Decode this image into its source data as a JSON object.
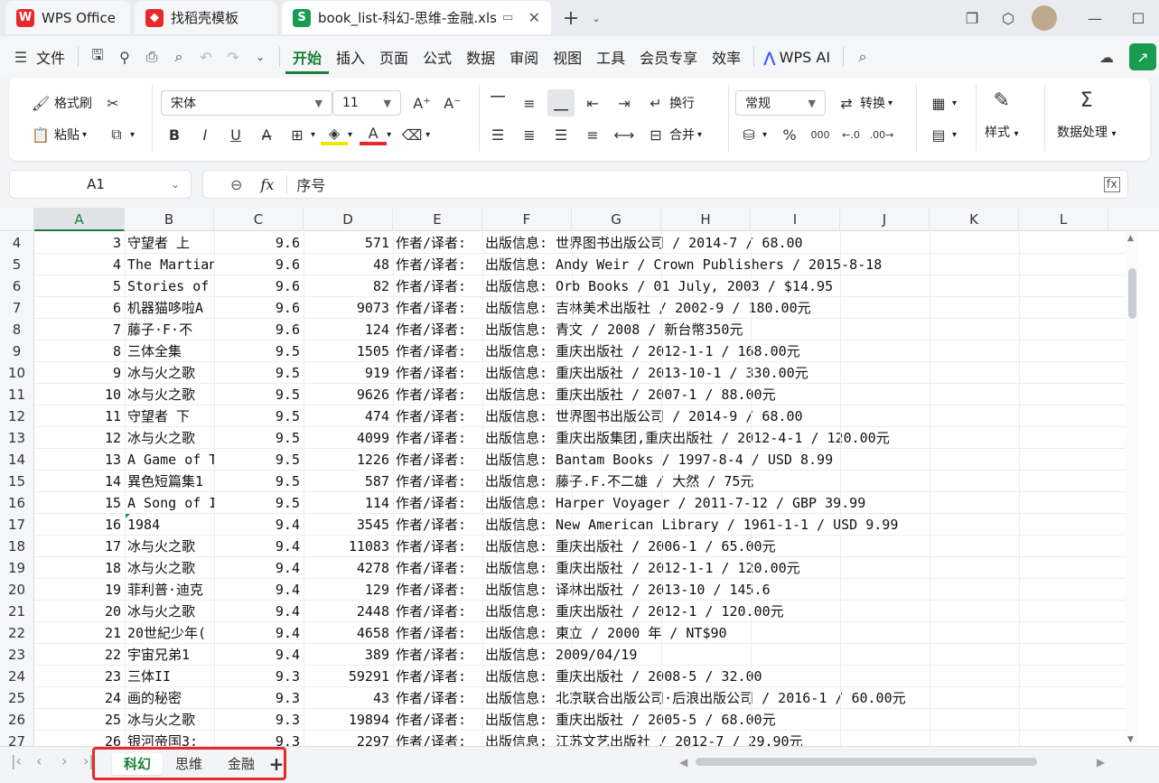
{
  "window": {
    "tabs": [
      {
        "label": "WPS Office",
        "logo": "W",
        "logo_color": "#e8292b"
      },
      {
        "label": "找稻壳模板",
        "logo": "◆",
        "logo_color": "#e8292b"
      },
      {
        "label": "book_list-科幻-思维-金融.xls",
        "logo": "S",
        "logo_color": "#1a9b52"
      }
    ]
  },
  "menu": {
    "file": "文件",
    "items": [
      "开始",
      "插入",
      "页面",
      "公式",
      "数据",
      "审阅",
      "视图",
      "工具",
      "会员专享",
      "效率"
    ],
    "active": "开始",
    "ai_label": "WPS AI"
  },
  "ribbon": {
    "format_painter": "格式刷",
    "paste": "粘贴",
    "font_name": "宋体",
    "font_size": "11",
    "wrap": "换行",
    "merge": "合并",
    "number_format": "常规",
    "convert": "转换",
    "style": "样式",
    "data_process": "数据处理"
  },
  "formula_bar": {
    "cell_ref": "A1",
    "content": "序号"
  },
  "columns": [
    "A",
    "B",
    "C",
    "D",
    "E",
    "F",
    "G",
    "H",
    "I",
    "J",
    "K",
    "L"
  ],
  "selected_column": "A",
  "rows": [
    {
      "rn": "4",
      "a": "3",
      "b": "守望者 上",
      "c": "9.6",
      "d": "571",
      "e": "作者/译者:",
      "f": "出版信息:  世界图书出版公司 / 2014-7 / 68.00"
    },
    {
      "rn": "5",
      "a": "4",
      "b": "The Martian",
      "c": "9.6",
      "d": "48",
      "e": "作者/译者:",
      "f": "出版信息: Andy Weir / Crown Publishers / 2015-8-18"
    },
    {
      "rn": "6",
      "a": "5",
      "b": "Stories of",
      "c": "9.6",
      "d": "82",
      "e": "作者/译者:",
      "f": "出版信息:  Orb Books / 01 July, 2003 / $14.95"
    },
    {
      "rn": "7",
      "a": "6",
      "b": "机器猫哆啦A",
      "c": "9.6",
      "d": "9073",
      "e": "作者/译者:",
      "f": "出版信息:  吉林美术出版社 / 2002-9 / 180.00元"
    },
    {
      "rn": "8",
      "a": "7",
      "b": "藤子·F·不",
      "c": "9.6",
      "d": "124",
      "e": "作者/译者:",
      "f": "出版信息:  青文 / 2008 / 新台幣350元"
    },
    {
      "rn": "9",
      "a": "8",
      "b": "三体全集",
      "c": "9.5",
      "d": "1505",
      "e": "作者/译者:",
      "f": "出版信息:  重庆出版社 / 2012-1-1 / 168.00元"
    },
    {
      "rn": "10",
      "a": "9",
      "b": "冰与火之歌",
      "c": "9.5",
      "d": "919",
      "e": "作者/译者:",
      "f": "出版信息:  重庆出版社 / 2013-10-1 / 330.00元"
    },
    {
      "rn": "11",
      "a": "10",
      "b": "冰与火之歌",
      "c": "9.5",
      "d": "9626",
      "e": "作者/译者:",
      "f": "出版信息:  重庆出版社 / 2007-1 / 88.00元"
    },
    {
      "rn": "12",
      "a": "11",
      "b": "守望者 下",
      "c": "9.5",
      "d": "474",
      "e": "作者/译者:",
      "f": "出版信息:  世界图书出版公司 / 2014-9 / 68.00"
    },
    {
      "rn": "13",
      "a": "12",
      "b": "冰与火之歌",
      "c": "9.5",
      "d": "4099",
      "e": "作者/译者:",
      "f": "出版信息:  重庆出版集团,重庆出版社 / 2012-4-1 / 120.00元"
    },
    {
      "rn": "14",
      "a": "13",
      "b": "A Game of T",
      "c": "9.5",
      "d": "1226",
      "e": "作者/译者:",
      "f": "出版信息:  Bantam Books / 1997-8-4 / USD 8.99"
    },
    {
      "rn": "15",
      "a": "14",
      "b": "異色短篇集1",
      "c": "9.5",
      "d": "587",
      "e": "作者/译者:",
      "f": "出版信息: 藤子.F.不二雄 / 大然 / 75元"
    },
    {
      "rn": "16",
      "a": "15",
      "b": "A Song of I",
      "c": "9.5",
      "d": "114",
      "e": "作者/译者:",
      "f": "出版信息:  Harper Voyager / 2011-7-12 / GBP 39.99"
    },
    {
      "rn": "17",
      "a": "16",
      "b": "1984",
      "c": "9.4",
      "d": "3545",
      "e": "作者/译者:",
      "f": "出版信息:  New American Library / 1961-1-1 / USD 9.99"
    },
    {
      "rn": "18",
      "a": "17",
      "b": "冰与火之歌",
      "c": "9.4",
      "d": "11083",
      "e": "作者/译者:",
      "f": "出版信息:  重庆出版社 / 2006-1 / 65.00元"
    },
    {
      "rn": "19",
      "a": "18",
      "b": "冰与火之歌",
      "c": "9.4",
      "d": "4278",
      "e": "作者/译者:",
      "f": "出版信息:  重庆出版社 / 2012-1-1 / 120.00元"
    },
    {
      "rn": "20",
      "a": "19",
      "b": "菲利普·迪克",
      "c": "9.4",
      "d": "129",
      "e": "作者/译者:",
      "f": "出版信息:  译林出版社 / 2013-10 / 145.6"
    },
    {
      "rn": "21",
      "a": "20",
      "b": "冰与火之歌",
      "c": "9.4",
      "d": "2448",
      "e": "作者/译者:",
      "f": "出版信息:  重庆出版社 / 2012-1 / 120.00元"
    },
    {
      "rn": "22",
      "a": "21",
      "b": "20世紀少年(",
      "c": "9.4",
      "d": "4658",
      "e": "作者/译者:",
      "f": "出版信息:  東立 / 2000 年 / NT$90"
    },
    {
      "rn": "23",
      "a": "22",
      "b": "宇宙兄弟1",
      "c": "9.4",
      "d": "389",
      "e": "作者/译者:",
      "f": "出版信息:  2009/04/19"
    },
    {
      "rn": "24",
      "a": "23",
      "b": "三体II",
      "c": "9.3",
      "d": "59291",
      "e": "作者/译者:",
      "f": "出版信息:  重庆出版社 / 2008-5 / 32.00"
    },
    {
      "rn": "25",
      "a": "24",
      "b": "画的秘密",
      "c": "9.3",
      "d": "43",
      "e": "作者/译者:",
      "f": "出版信息:  北京联合出版公司·后浪出版公司 / 2016-1 / 60.00元"
    },
    {
      "rn": "26",
      "a": "25",
      "b": "冰与火之歌",
      "c": "9.3",
      "d": "19894",
      "e": "作者/译者:",
      "f": "出版信息:  重庆出版社 / 2005-5 / 68.00元"
    },
    {
      "rn": "27",
      "a": "26",
      "b": "银河帝国3:",
      "c": "9.3",
      "d": "2297",
      "e": "作者/译者:",
      "f": "出版信息:  江苏文艺出版社 / 2012-7 / 29.90元"
    }
  ],
  "sheets": [
    "科幻",
    "思维",
    "金融"
  ],
  "active_sheet": "科幻",
  "add_sheet": "+",
  "colors": {
    "accent": "#1a7f37",
    "highlight": "#e8292b"
  }
}
